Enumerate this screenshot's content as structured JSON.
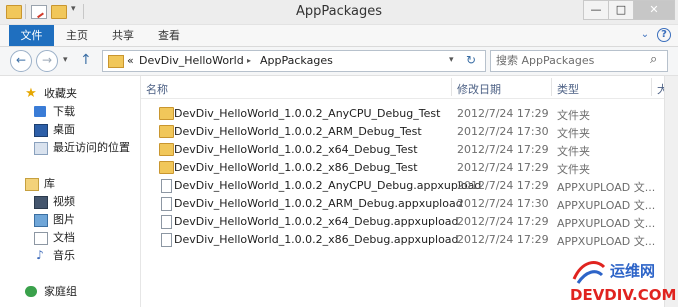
{
  "window": {
    "title": "AppPackages",
    "minimize": "—",
    "maximize": "□",
    "close": "✕"
  },
  "ribbon": {
    "tabs": [
      "文件",
      "主页",
      "共享",
      "查看"
    ],
    "expand": "⌄",
    "help": "?"
  },
  "navbar": {
    "back": "←",
    "forward": "→",
    "recent": "▾",
    "up": "↑",
    "crumb_overflow": "«",
    "crumbs": [
      "DevDiv_HelloWorld",
      "AppPackages"
    ],
    "crumb_sep": "▸",
    "dropdown": "▾",
    "refresh": "↻",
    "search_placeholder": "搜索 AppPackages",
    "search_icon": "⌕"
  },
  "sidebar": {
    "favorites": {
      "label": "收藏夹",
      "icon": "star-icon"
    },
    "favorites_items": [
      {
        "label": "下载",
        "icon": "downloads-icon"
      },
      {
        "label": "桌面",
        "icon": "desktop-icon"
      },
      {
        "label": "最近访问的位置",
        "icon": "recent-places-icon"
      }
    ],
    "libraries": {
      "label": "库",
      "icon": "library-icon"
    },
    "library_items": [
      {
        "label": "视频",
        "icon": "videos-icon"
      },
      {
        "label": "图片",
        "icon": "pictures-icon"
      },
      {
        "label": "文档",
        "icon": "documents-icon"
      },
      {
        "label": "音乐",
        "icon": "music-icon"
      }
    ],
    "homegroup": {
      "label": "家庭组",
      "icon": "homegroup-icon"
    }
  },
  "columns": {
    "name": "名称",
    "date": "修改日期",
    "type": "类型",
    "size": "大"
  },
  "files": [
    {
      "name": "DevDiv_HelloWorld_1.0.0.2_AnyCPU_Debug_Test",
      "date": "2012/7/24 17:29",
      "type": "文件夹",
      "kind": "folder"
    },
    {
      "name": "DevDiv_HelloWorld_1.0.0.2_ARM_Debug_Test",
      "date": "2012/7/24 17:30",
      "type": "文件夹",
      "kind": "folder"
    },
    {
      "name": "DevDiv_HelloWorld_1.0.0.2_x64_Debug_Test",
      "date": "2012/7/24 17:29",
      "type": "文件夹",
      "kind": "folder"
    },
    {
      "name": "DevDiv_HelloWorld_1.0.0.2_x86_Debug_Test",
      "date": "2012/7/24 17:29",
      "type": "文件夹",
      "kind": "folder"
    },
    {
      "name": "DevDiv_HelloWorld_1.0.0.2_AnyCPU_Debug.appxupload",
      "date": "2012/7/24 17:29",
      "type": "APPXUPLOAD 文...",
      "kind": "file"
    },
    {
      "name": "DevDiv_HelloWorld_1.0.0.2_ARM_Debug.appxupload",
      "date": "2012/7/24 17:30",
      "type": "APPXUPLOAD 文...",
      "kind": "file"
    },
    {
      "name": "DevDiv_HelloWorld_1.0.0.2_x64_Debug.appxupload",
      "date": "2012/7/24 17:29",
      "type": "APPXUPLOAD 文...",
      "kind": "file"
    },
    {
      "name": "DevDiv_HelloWorld_1.0.0.2_x86_Debug.appxupload",
      "date": "2012/7/24 17:29",
      "type": "APPXUPLOAD 文...",
      "kind": "file"
    }
  ],
  "watermark": {
    "line1": "运维网",
    "line2": "DEVDIV.COM"
  }
}
